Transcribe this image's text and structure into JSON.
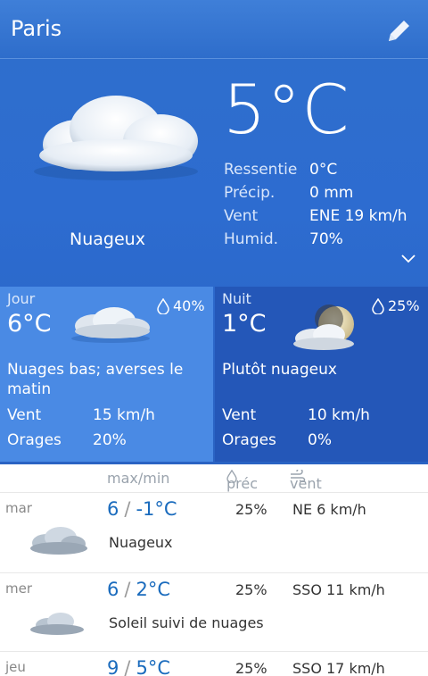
{
  "header": {
    "city": "Paris"
  },
  "current": {
    "temperature": "5°C",
    "condition": "Nuageux",
    "details": [
      {
        "label": "Ressentie",
        "value": "0°C"
      },
      {
        "label": "Précip.",
        "value": "0 mm"
      },
      {
        "label": "Vent",
        "value": "ENE 19 km/h"
      },
      {
        "label": "Humid.",
        "value": "70%"
      }
    ]
  },
  "day": {
    "label": "Jour",
    "temperature": "6°C",
    "rain": "40%",
    "description": "Nuages bas; averses le matin",
    "wind_label": "Vent",
    "wind": "15 km/h",
    "storm_label": "Orages",
    "storm": "20%"
  },
  "night": {
    "label": "Nuit",
    "temperature": "1°C",
    "rain": "25%",
    "description": "Plutôt nuageux",
    "wind_label": "Vent",
    "wind": "10 km/h",
    "storm_label": "Orages",
    "storm": "0%"
  },
  "forecast_header": {
    "maxmin": "max/min",
    "prec": "préc",
    "wind": "vent"
  },
  "forecast": [
    {
      "day": "mar",
      "max": "6",
      "min": "-1°C",
      "prec": "25%",
      "wind": "NE 6 km/h",
      "condition": "Nuageux"
    },
    {
      "day": "mer",
      "max": "6",
      "min": "2°C",
      "prec": "25%",
      "wind": "SSO 11 km/h",
      "condition": "Soleil suivi de nuages"
    },
    {
      "day": "jeu",
      "max": "9",
      "min": "5°C",
      "prec": "25%",
      "wind": "SSO 17 km/h",
      "condition": ""
    }
  ],
  "colors": {
    "accent": "#1a6bbd",
    "sky_top": "#2f6fcc",
    "day_panel": "#4a8ae4",
    "night_panel": "#2457b8"
  },
  "icons": [
    "pencil-icon",
    "cloud-icon",
    "chevron-down-icon",
    "droplet-icon",
    "moon-cloud-icon",
    "wind-icon"
  ]
}
